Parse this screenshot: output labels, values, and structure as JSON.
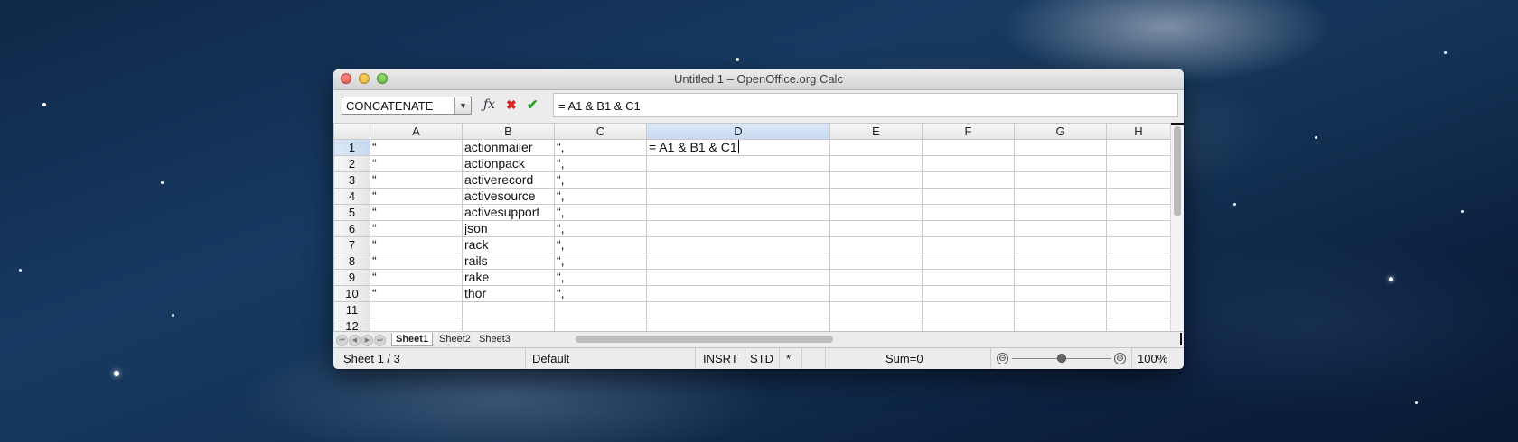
{
  "window": {
    "title": "Untitled 1 – OpenOffice.org Calc"
  },
  "formula_bar": {
    "name_box": "CONCATENATE",
    "dropdown_glyph": "▼",
    "formula": "= A1 & B1 & C1",
    "icons": [
      "function-wizard-icon",
      "cancel-icon",
      "accept-icon"
    ]
  },
  "columns": [
    "A",
    "B",
    "C",
    "D",
    "E",
    "F",
    "G",
    "H"
  ],
  "selected_column": "D",
  "rows": [
    {
      "n": "1",
      "a": "“",
      "b": "actionmailer",
      "c": "“,",
      "d": "= A1 & B1 & C1"
    },
    {
      "n": "2",
      "a": "“",
      "b": "actionpack",
      "c": "“,",
      "d": ""
    },
    {
      "n": "3",
      "a": "“",
      "b": "activerecord",
      "c": "“,",
      "d": ""
    },
    {
      "n": "4",
      "a": "“",
      "b": "activesource",
      "c": "“,",
      "d": ""
    },
    {
      "n": "5",
      "a": "“",
      "b": "activesupport",
      "c": "“,",
      "d": ""
    },
    {
      "n": "6",
      "a": "“",
      "b": "json",
      "c": "“,",
      "d": ""
    },
    {
      "n": "7",
      "a": "“",
      "b": "rack",
      "c": "“,",
      "d": ""
    },
    {
      "n": "8",
      "a": "“",
      "b": "rails",
      "c": "“,",
      "d": ""
    },
    {
      "n": "9",
      "a": "“",
      "b": "rake",
      "c": "“,",
      "d": ""
    },
    {
      "n": "10",
      "a": "“",
      "b": "thor",
      "c": "“,",
      "d": ""
    },
    {
      "n": "11",
      "a": "",
      "b": "",
      "c": "",
      "d": ""
    },
    {
      "n": "12",
      "a": "",
      "b": "",
      "c": "",
      "d": ""
    }
  ],
  "sheet_tabs": [
    "Sheet1",
    "Sheet2",
    "Sheet3"
  ],
  "active_sheet": "Sheet1",
  "status": {
    "sheet": "Sheet 1 / 3",
    "style": "Default",
    "insert_mode": "INSRT",
    "selection_mode": "STD",
    "modified": "*",
    "sum": "Sum=0",
    "zoom_minus": "⊖",
    "zoom_plus": "⊕",
    "zoom": "100%"
  }
}
